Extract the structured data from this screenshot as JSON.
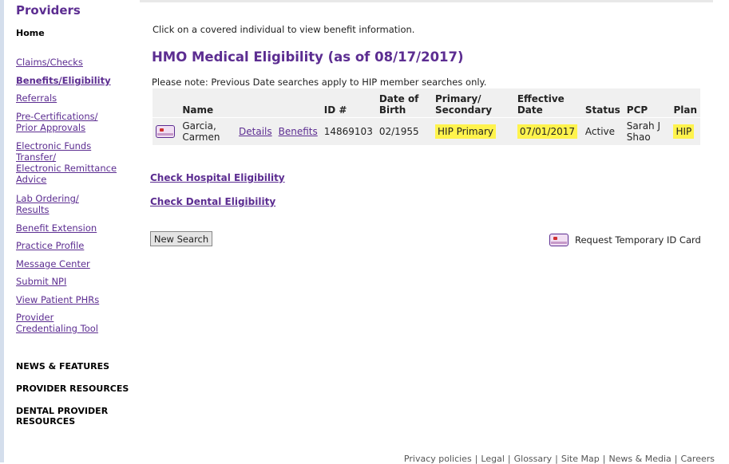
{
  "sidebar": {
    "title": "Providers",
    "home": "Home",
    "links": [
      {
        "label": "Claims/Checks"
      },
      {
        "label": "Benefits/Eligibility"
      },
      {
        "label": "Referrals"
      },
      {
        "label": "Pre-Certifications/",
        "label2": "Prior Approvals"
      },
      {
        "label": "Electronic Funds",
        "label2": "Transfer/",
        "label3": "Electronic Remittance",
        "label4": "Advice"
      },
      {
        "label": "Lab Ordering/",
        "label2": "Results"
      },
      {
        "label": "Benefit Extension"
      },
      {
        "label": "Practice Profile"
      },
      {
        "label": "Message Center"
      },
      {
        "label": "Submit NPI"
      },
      {
        "label": "View Patient PHRs"
      },
      {
        "label": "Provider",
        "label2": "Credentialing Tool"
      }
    ],
    "sections": [
      {
        "label": "NEWS & FEATURES"
      },
      {
        "label": "PROVIDER RESOURCES"
      },
      {
        "label": "DENTAL PROVIDER",
        "label2": "RESOURCES"
      }
    ]
  },
  "main": {
    "instruction": "Click on a covered individual to view benefit information.",
    "title": "HMO Medical Eligibility (as of 08/17/2017)",
    "note": "Please note: Previous Date searches apply to HIP member searches only.",
    "table": {
      "headers": {
        "name": "Name",
        "id": "ID #",
        "dob_1": "Date of",
        "dob_2": "Birth",
        "primary_1": "Primary/",
        "primary_2": "Secondary",
        "effective_1": "Effective",
        "effective_2": "Date",
        "status": "Status",
        "pcp": "PCP",
        "plan": "Plan"
      },
      "rows": [
        {
          "name_1": "Garcia,",
          "name_2": "Carmen",
          "details": "Details",
          "benefits": "Benefits",
          "id": "14869103",
          "dob": "02/1955",
          "primary": "HIP Primary",
          "effective": "07/01/2017",
          "status": "Active",
          "pcp_1": "Sarah J",
          "pcp_2": "Shao",
          "plan": "HIP"
        }
      ]
    },
    "check_hospital": "Check Hospital Eligibility",
    "check_dental": "Check Dental Eligibility",
    "new_search": "New Search",
    "temp_id_card": "Request Temporary ID Card"
  },
  "footer": {
    "links": [
      "Privacy policies",
      "Legal",
      "Glossary",
      "Site Map",
      "News & Media",
      "Careers"
    ]
  },
  "colors": {
    "accent": "#5c2d91",
    "highlight": "#fff34d",
    "table_bg": "#f0f0f0"
  },
  "icons": {
    "id_card": "id-card-icon"
  }
}
